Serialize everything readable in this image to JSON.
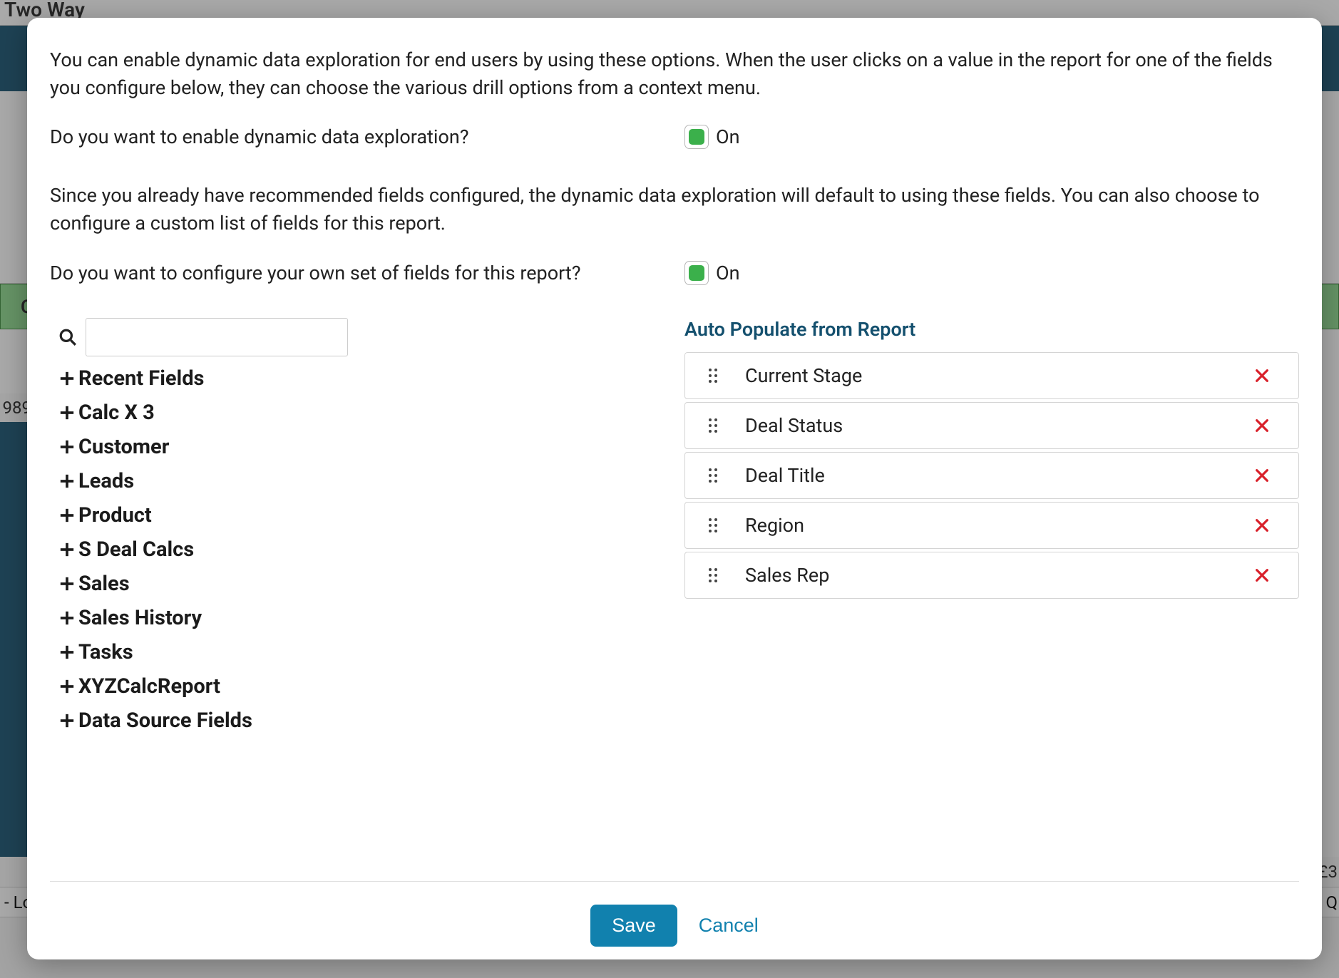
{
  "bg": {
    "title_fragment": "Two Way",
    "green_header_fragment": "C",
    "row_number_fragment": "989",
    "footer_left": "- Lo",
    "footer_right": "Q",
    "right_col_fragment": "£3"
  },
  "modal": {
    "intro1": "You can enable dynamic data exploration for end users by using these options. When the user clicks on a value in the report for one of the fields you configure below, they can choose the various drill options from a context menu.",
    "q1": "Do you want to enable dynamic data exploration?",
    "q1_state": "On",
    "intro2": "Since you already have recommended fields configured, the dynamic data exploration will default to using these fields. You can also choose to configure a custom list of fields for this report.",
    "q2": "Do you want to configure your own set of fields for this report?",
    "q2_state": "On",
    "auto_populate": "Auto Populate from Report",
    "search_placeholder": "",
    "save": "Save",
    "cancel": "Cancel"
  },
  "tree": {
    "items": [
      "Recent Fields",
      "Calc X 3",
      "Customer",
      "Leads",
      "Product",
      "S Deal Calcs",
      "Sales",
      "Sales History",
      "Tasks",
      "XYZCalcReport",
      "Data Source Fields"
    ]
  },
  "selected": {
    "items": [
      "Current Stage",
      "Deal Status",
      "Deal Title",
      "Region",
      "Sales Rep"
    ]
  }
}
